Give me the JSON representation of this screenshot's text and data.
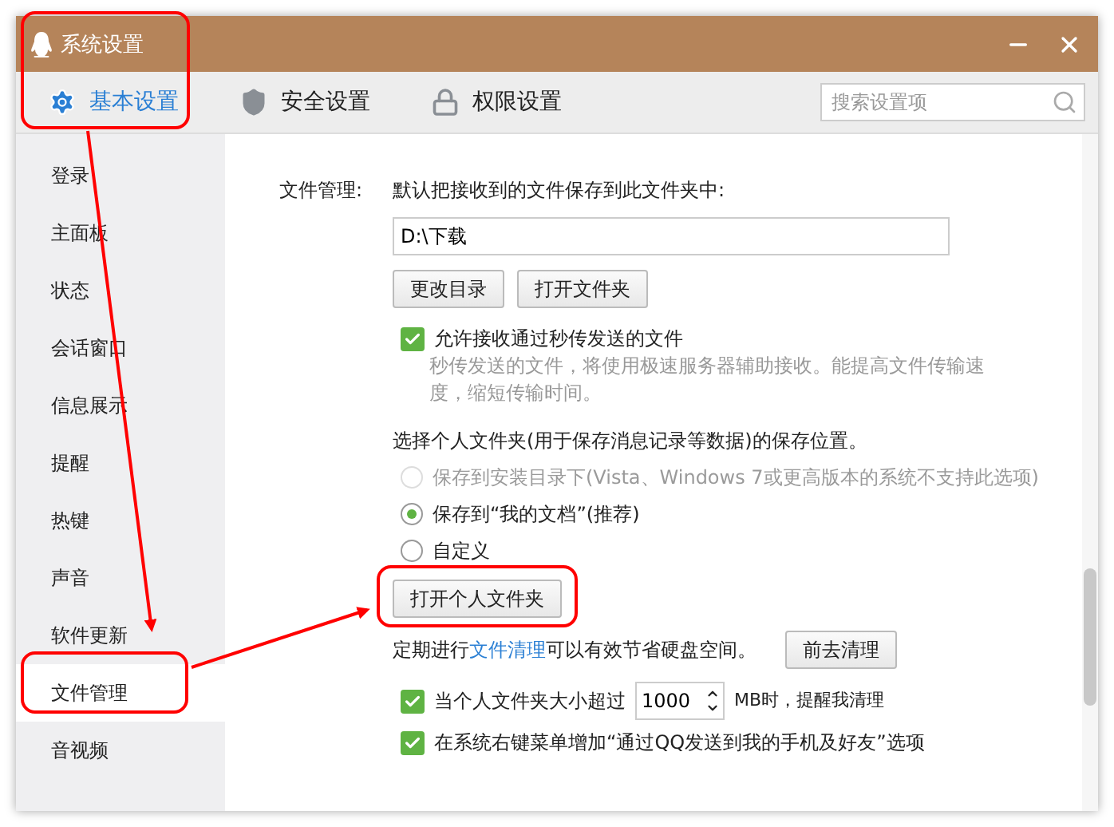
{
  "window": {
    "title": "系统设置"
  },
  "tabs": [
    {
      "label": "基本设置",
      "selected": true,
      "kind": "gear"
    },
    {
      "label": "安全设置",
      "selected": false,
      "kind": "shield"
    },
    {
      "label": "权限设置",
      "selected": false,
      "kind": "lock"
    }
  ],
  "search": {
    "placeholder": "搜索设置项"
  },
  "sidebar": {
    "items": [
      {
        "label": "登录",
        "selected": false
      },
      {
        "label": "主面板",
        "selected": false
      },
      {
        "label": "状态",
        "selected": false
      },
      {
        "label": "会话窗口",
        "selected": false
      },
      {
        "label": "信息展示",
        "selected": false
      },
      {
        "label": "提醒",
        "selected": false
      },
      {
        "label": "热键",
        "selected": false
      },
      {
        "label": "声音",
        "selected": false
      },
      {
        "label": "软件更新",
        "selected": false
      },
      {
        "label": "文件管理",
        "selected": true
      },
      {
        "label": "音视频",
        "selected": false
      }
    ]
  },
  "file_management": {
    "label": "文件管理:",
    "intro": "默认把接收到的文件保存到此文件夹中:",
    "path": "D:\\下载",
    "buttons": [
      "更改目录",
      "打开文件夹"
    ],
    "instant_transfer": {
      "label": "允许接收通过秒传发送的文件",
      "checked": true,
      "description": "秒传发送的文件，将使用极速服务器辅助接收。能提高文件传输速度，缩短传输时间。"
    },
    "folder_intro": "选择个人文件夹(用于保存消息记录等数据)的保存位置。",
    "locations": [
      {
        "label": "保存到安装目录下(Vista、Windows 7或更高版本的系统不支持此选项)",
        "selected": false,
        "disabled": true
      },
      {
        "label": "保存到“我的文档”(推荐)",
        "selected": true,
        "disabled": false
      },
      {
        "label": "自定义",
        "selected": false,
        "disabled": false
      }
    ],
    "open_folder_button": "打开个人文件夹",
    "cleanup": {
      "before": "定期进行",
      "link": "文件清理",
      "after": "可以有效节省硬盘空间。",
      "button": "前去清理"
    },
    "size_limit": {
      "checked": true,
      "before": "当个人文件夹大小超过",
      "value": "1000",
      "after": "MB时，提醒我清理"
    },
    "context_menu": {
      "checked": true,
      "label": "在系统右键菜单增加“通过QQ发送到我的手机及好友”选项"
    }
  }
}
